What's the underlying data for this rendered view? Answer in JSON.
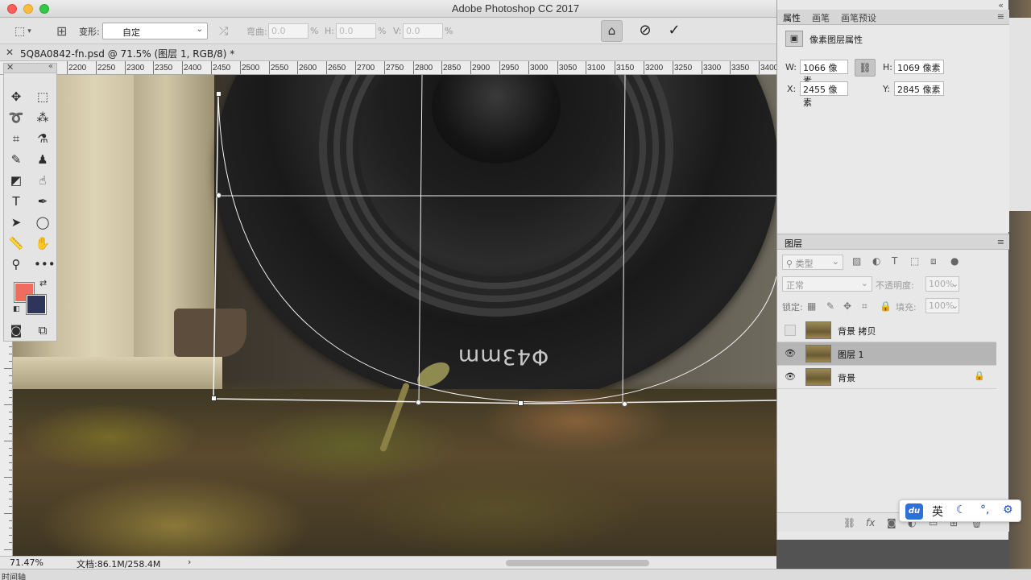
{
  "app": {
    "title": "Adobe Photoshop CC 2017"
  },
  "options_bar": {
    "warp_label": "变形:",
    "warp_value": "自定",
    "bend_label": "弯曲:",
    "bend_value": "0.0",
    "h_label": "H:",
    "h_value": "0.0",
    "v_label": "V:",
    "v_value": "0.0",
    "percent": "%",
    "cancel_icon": "cancel-icon",
    "commit_icon": "commit-icon"
  },
  "document": {
    "tab_title": "5Q8A0842-fn.psd @ 71.5% (图层 1, RGB/8) *"
  },
  "ruler": {
    "labels": [
      "2200",
      "2250",
      "2300",
      "2350",
      "2400",
      "2450",
      "2500",
      "2550",
      "2600",
      "2650",
      "2700",
      "2750",
      "2800",
      "2850",
      "2900",
      "2950",
      "3000",
      "3050",
      "3100",
      "3150",
      "3200",
      "3250",
      "3300",
      "3350",
      "3400"
    ]
  },
  "canvas": {
    "lens_marking": "Φ43mm"
  },
  "status": {
    "zoom": "71.47%",
    "doc_size": "文档:86.1M/258.4M",
    "arrow": "›"
  },
  "timeline": {
    "label": "时间轴"
  },
  "properties": {
    "tabs": [
      "属性",
      "画笔",
      "画笔预设"
    ],
    "title": "像素图层属性",
    "w_label": "W:",
    "w_value": "1066 像素",
    "h_label": "H:",
    "h_value": "1069 像素",
    "x_label": "X:",
    "x_value": "2455 像素",
    "y_label": "Y:",
    "y_value": "2845 像素"
  },
  "layers": {
    "tab": "图层",
    "kind_filter": "类型",
    "blend_mode": "正常",
    "opacity_label": "不透明度:",
    "opacity_value": "100%",
    "lock_label": "锁定:",
    "fill_label": "填充:",
    "fill_value": "100%",
    "items": [
      {
        "name": "背景 拷贝",
        "visible": false,
        "selected": false,
        "locked": false
      },
      {
        "name": "图层 1",
        "visible": true,
        "selected": true,
        "locked": false
      },
      {
        "name": "背景",
        "visible": true,
        "selected": false,
        "locked": true
      }
    ]
  },
  "ime": {
    "logo": "du",
    "lang": "英",
    "items": [
      "moon-icon",
      "punctuation-icon",
      "settings-icon"
    ]
  },
  "colors": {
    "foreground": "#f06c5e",
    "background": "#2f355a",
    "ime_blue": "#2f6fd6"
  }
}
